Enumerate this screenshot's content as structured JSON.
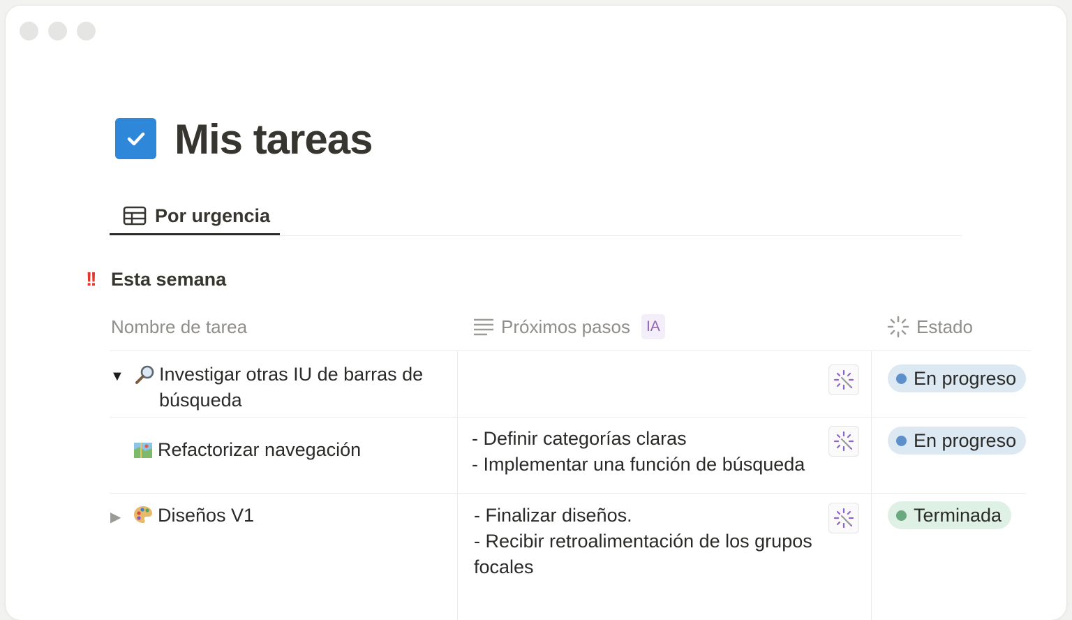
{
  "window": {
    "controls": [
      "close",
      "minimize",
      "zoom"
    ]
  },
  "page": {
    "title": "Mis tareas",
    "icon": "checkbox-icon",
    "icon_color": "#2f87da"
  },
  "view_tab": {
    "label": "Por urgencia",
    "icon": "table-icon"
  },
  "group": {
    "label": "Esta semana",
    "icon": "double-exclamation-icon"
  },
  "columns": {
    "name": "Nombre de tarea",
    "steps": "Próximos pasos",
    "steps_badge": "IA",
    "status": "Estado"
  },
  "rows": [
    {
      "name_line1": "Investigar otras IU de barras de",
      "name_line2": "búsqueda",
      "icon": "magnifying-glass-icon",
      "toggle": "expanded",
      "steps_line1": "",
      "steps_line2": "",
      "steps_line3": "",
      "status": "En progreso",
      "status_color": "#5d8fcb"
    },
    {
      "name_line1": "Refactorizar navegación",
      "icon": "map-icon",
      "steps_line1": "- Definir categorías claras",
      "steps_line2": "- Implementar una función de búsqueda",
      "status": "En progreso",
      "status_color": "#5d8fcb"
    },
    {
      "name_line1": "Diseños V1",
      "icon": "palette-icon",
      "toggle": "collapsed",
      "steps_line1": "- Finalizar diseños.",
      "steps_line2": "- Recibir retroalimentación de los grupos",
      "steps_line3": "focales",
      "status": "Terminada",
      "status_color": "#6aa87f"
    }
  ]
}
